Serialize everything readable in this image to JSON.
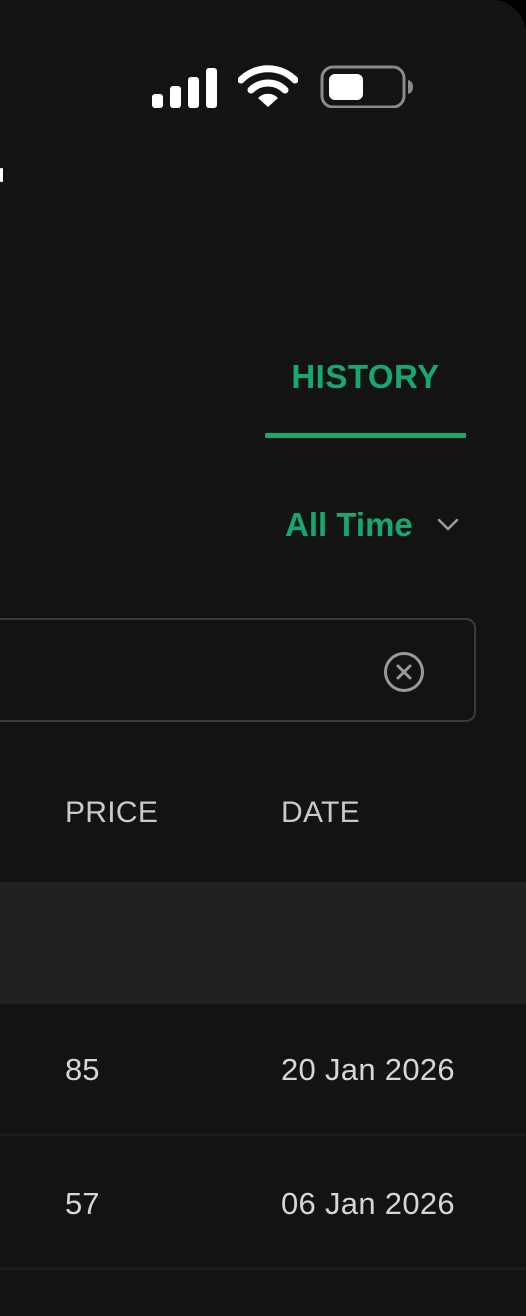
{
  "status_bar": {
    "signal_icon": "cellular-signal-icon",
    "wifi_icon": "wifi-icon",
    "battery_icon": "battery-icon",
    "battery_level_percent": 50
  },
  "tabs": [
    {
      "label": "HISTORY",
      "active": true
    }
  ],
  "filter": {
    "selected": "All Time",
    "icon": "chevron-down-icon"
  },
  "search": {
    "value": "",
    "clear_icon": "clear-circle-icon"
  },
  "table": {
    "columns": [
      "PRICE",
      "DATE"
    ],
    "rows": [
      {
        "price": "85",
        "date": "20 Jan 2026"
      },
      {
        "price": "57",
        "date": "06 Jan 2026"
      }
    ]
  },
  "colors": {
    "accent": "#16a86e",
    "background": "#131313",
    "band": "#212121"
  }
}
